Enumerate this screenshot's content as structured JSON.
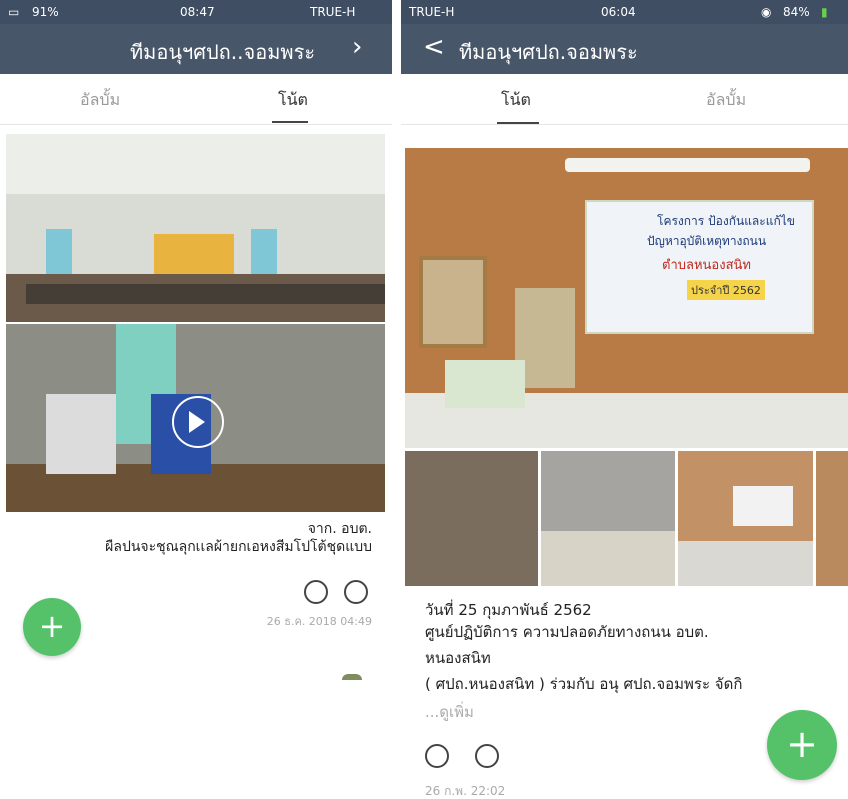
{
  "left": {
    "status": {
      "carrier": "TRUE-H",
      "time": "08:47",
      "battery": "91%"
    },
    "header": {
      "title": "ทีมอนุฯศปถ..จอมพระ"
    },
    "tabs": [
      {
        "label": "โน้ต"
      },
      {
        "label": "อัลบั้ม"
      }
    ],
    "post": {
      "line1": "จาก. อบต.",
      "line2": "ผืลปนจะชุณลุกเเลผ้ายกเอหงสีมโปโต้ชุดแบบ",
      "timestamp": "26 ธ.ค. 2018 04:49"
    }
  },
  "right": {
    "status": {
      "carrier": "TRUE-H",
      "time": "06:04",
      "battery": "84%"
    },
    "header": {
      "back": "<",
      "title": "ทีมอนุฯศปถ.จอมพระ"
    },
    "tabs": [
      {
        "label": "โน้ต"
      },
      {
        "label": "อัลบั้ม"
      }
    ],
    "banner": {
      "line1": "โครงการ ป้องกันและแก้ไข",
      "line2": "ปัญหาอุบัติเหตุทางถนน",
      "line3": "ตำบลหนองสนิท",
      "line4": "ประจำปี 2562"
    },
    "post": {
      "line1": "วันที่ 25 กุมภาพันธ์ 2562",
      "line2": "ศูนย์ปฏิบัติการ ความปลอดภัยทางถนน อบต.",
      "line3": "หนองสนิท",
      "line4": "( ศปถ.หนองสนิท ) ร่วมกับ อนุ ศปถ.จอมพระ จัดกิ",
      "see_more": "...ดูเพิ่ม",
      "timestamp": "26 ก.พ. 22:02"
    }
  },
  "colors": {
    "header": "#475669",
    "status": "#3f4e63",
    "fab": "#55c26a"
  }
}
